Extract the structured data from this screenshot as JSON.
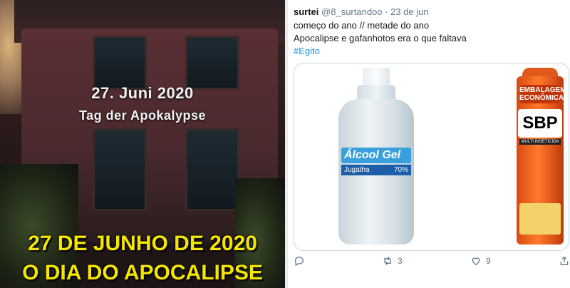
{
  "meme": {
    "german_line1": "27. Juni 2020",
    "german_line2": "Tag der Apokalypse",
    "portuguese_line1": "27 DE JUNHO DE 2020",
    "portuguese_line2": "O DIA DO APOCALIPSE"
  },
  "tweet": {
    "display_name": "surtei",
    "handle": "@8_surtandoo",
    "separator": "·",
    "date": "23 de jun",
    "line1": "começo do ano // metade do ano",
    "line2": "Apocalipse e gafanhotos era o que faltava",
    "hashtag": "#Egito",
    "media": {
      "bottle_label_top": "Álcool Gel",
      "bottle_label_brand": "Jugatha",
      "bottle_label_percent": "70%",
      "can_label_line1": "EMBALAGEM",
      "can_label_line2": "ECONÔMICA",
      "can_brand": "SBP",
      "can_subtitle": "MULTI INSETICIDA"
    },
    "actions": {
      "reply_count": "",
      "retweet_count": "3",
      "like_count": "9"
    }
  }
}
